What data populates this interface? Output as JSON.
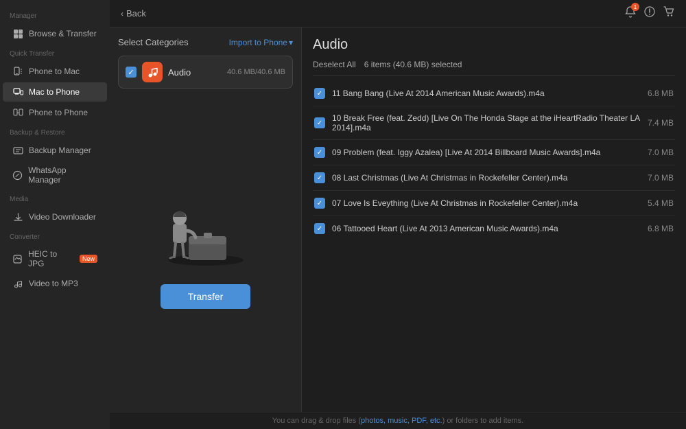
{
  "sidebar": {
    "sections": [
      {
        "label": "Manager",
        "items": [
          {
            "id": "browse-transfer",
            "label": "Browse & Transfer",
            "icon": "⊞",
            "active": false
          }
        ]
      },
      {
        "label": "Quick Transfer",
        "items": [
          {
            "id": "phone-to-mac",
            "label": "Phone to Mac",
            "icon": "📱",
            "active": false
          },
          {
            "id": "mac-to-phone",
            "label": "Mac to Phone",
            "icon": "💻",
            "active": true
          },
          {
            "id": "phone-to-phone",
            "label": "Phone to Phone",
            "icon": "📱",
            "active": false
          }
        ]
      },
      {
        "label": "Backup & Restore",
        "items": [
          {
            "id": "backup-manager",
            "label": "Backup Manager",
            "icon": "🗂",
            "active": false
          },
          {
            "id": "whatsapp-manager",
            "label": "WhatsApp Manager",
            "icon": "💬",
            "active": false
          }
        ]
      },
      {
        "label": "Media",
        "items": [
          {
            "id": "video-downloader",
            "label": "Video Downloader",
            "icon": "⬇",
            "active": false
          }
        ]
      },
      {
        "label": "Converter",
        "items": [
          {
            "id": "heic-to-jpg",
            "label": "HEIC to JPG",
            "icon": "🖼",
            "active": false,
            "badge": "New"
          },
          {
            "id": "video-to-mp3",
            "label": "Video to MP3",
            "icon": "🎵",
            "active": false
          }
        ]
      }
    ]
  },
  "topbar": {
    "back_label": "Back",
    "icons": [
      "🔔",
      "🔔",
      "🛒"
    ]
  },
  "left_panel": {
    "title": "Select Categories",
    "import_label": "Import to Phone",
    "category": {
      "name": "Audio",
      "size": "40.6 MB/40.6 MB",
      "checked": true
    },
    "transfer_label": "Transfer"
  },
  "right_panel": {
    "title": "Audio",
    "deselect_label": "Deselect All",
    "items_selected": "6 items (40.6 MB) selected",
    "items": [
      {
        "name": "11 Bang Bang (Live At 2014 American Music Awards).m4a",
        "size": "6.8 MB"
      },
      {
        "name": "10 Break Free (feat. Zedd) [Live On The Honda Stage at the iHeartRadio Theater LA 2014].m4a",
        "size": "7.4 MB"
      },
      {
        "name": "09 Problem (feat. Iggy Azalea)  [Live At 2014 Billboard Music Awards].m4a",
        "size": "7.0 MB"
      },
      {
        "name": "08 Last Christmas  (Live At Christmas in Rockefeller Center).m4a",
        "size": "7.0 MB"
      },
      {
        "name": "07 Love Is Eveything (Live At Christmas in Rockefeller Center).m4a",
        "size": "5.4 MB"
      },
      {
        "name": "06 Tattooed Heart (Live At 2013 American Music Awards).m4a",
        "size": "6.8 MB"
      }
    ]
  },
  "bottom_bar": {
    "text_before": "You can drag & drop files (",
    "link_text": "photos, music, PDF, etc.",
    "text_after": ") or folders to add items."
  }
}
